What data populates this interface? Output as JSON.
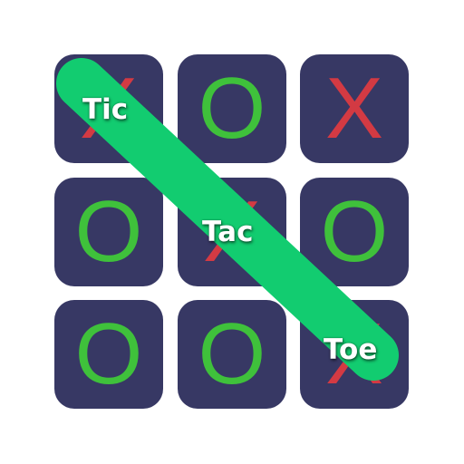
{
  "board": {
    "cells": [
      {
        "mark": "X"
      },
      {
        "mark": "O"
      },
      {
        "mark": "X"
      },
      {
        "mark": "O"
      },
      {
        "mark": "X"
      },
      {
        "mark": "O"
      },
      {
        "mark": "O"
      },
      {
        "mark": "O"
      },
      {
        "mark": "X"
      }
    ]
  },
  "title_words": {
    "first": "Tic",
    "second": "Tac",
    "third": "Toe"
  },
  "colors": {
    "tile": "#373864",
    "o_mark": "#3fc13b",
    "x_mark": "#d33a43",
    "win_line": "#12cc70"
  },
  "win_line": {
    "from_cell": 0,
    "to_cell": 8
  }
}
